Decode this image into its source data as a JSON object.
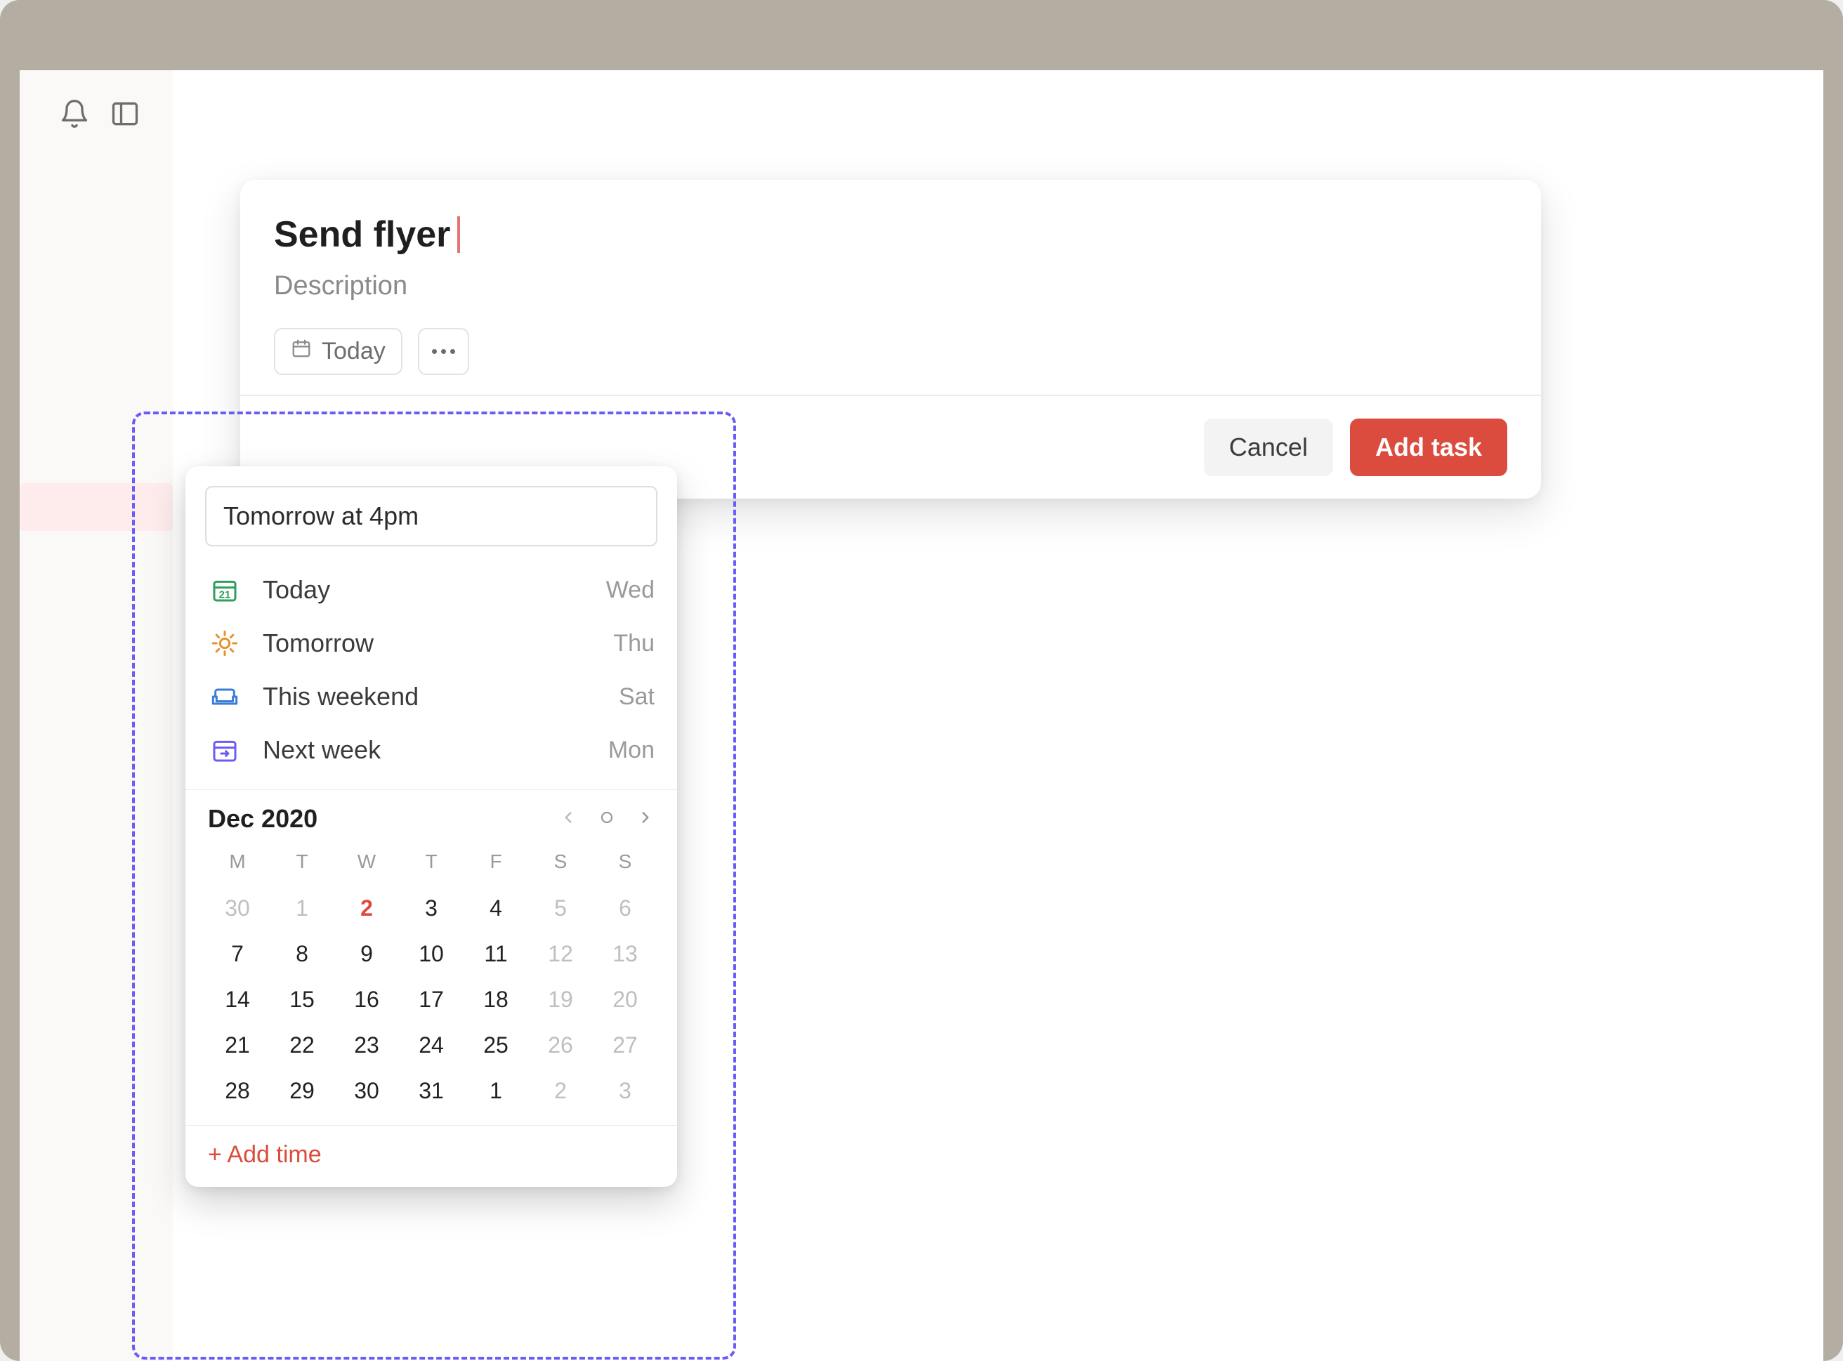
{
  "task": {
    "title": "Send flyer",
    "description_placeholder": "Description",
    "date_chip": "Today",
    "cancel": "Cancel",
    "add": "Add task"
  },
  "scheduler": {
    "input_value": "Tomorrow at 4pm",
    "quick": [
      {
        "label": "Today",
        "day": "Wed",
        "icon": "today-icon",
        "color": "#2e9e5b"
      },
      {
        "label": "Tomorrow",
        "day": "Thu",
        "icon": "sun-icon",
        "color": "#e6932e"
      },
      {
        "label": "This weekend",
        "day": "Sat",
        "icon": "couch-icon",
        "color": "#3a7dd9"
      },
      {
        "label": "Next week",
        "day": "Mon",
        "icon": "next-week-icon",
        "color": "#6a5cf5"
      }
    ],
    "month_label": "Dec 2020",
    "dow": [
      "M",
      "T",
      "W",
      "T",
      "F",
      "S",
      "S"
    ],
    "weeks": [
      [
        {
          "d": "30",
          "muted": true
        },
        {
          "d": "1",
          "muted": true
        },
        {
          "d": "2",
          "accent": true
        },
        {
          "d": "3"
        },
        {
          "d": "4"
        },
        {
          "d": "5",
          "muted": true
        },
        {
          "d": "6",
          "muted": true
        }
      ],
      [
        {
          "d": "7"
        },
        {
          "d": "8"
        },
        {
          "d": "9"
        },
        {
          "d": "10"
        },
        {
          "d": "11"
        },
        {
          "d": "12",
          "muted": true
        },
        {
          "d": "13",
          "muted": true
        }
      ],
      [
        {
          "d": "14"
        },
        {
          "d": "15"
        },
        {
          "d": "16"
        },
        {
          "d": "17"
        },
        {
          "d": "18"
        },
        {
          "d": "19",
          "muted": true
        },
        {
          "d": "20",
          "muted": true
        }
      ],
      [
        {
          "d": "21"
        },
        {
          "d": "22"
        },
        {
          "d": "23"
        },
        {
          "d": "24"
        },
        {
          "d": "25"
        },
        {
          "d": "26",
          "muted": true
        },
        {
          "d": "27",
          "muted": true
        }
      ],
      [
        {
          "d": "28"
        },
        {
          "d": "29"
        },
        {
          "d": "30"
        },
        {
          "d": "31"
        },
        {
          "d": "1"
        },
        {
          "d": "2",
          "muted": true
        },
        {
          "d": "3",
          "muted": true
        }
      ]
    ],
    "add_time": "+ Add time"
  }
}
